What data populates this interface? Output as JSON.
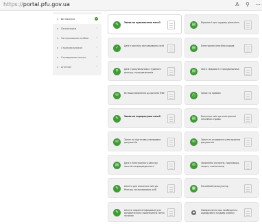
{
  "browser": {
    "url_scheme": "https://",
    "url_host": "portal.pfu.gov.ua",
    "reader_icon": "A",
    "zoom_icon": "⚲",
    "more_icon": "⋯"
  },
  "sidebar": {
    "items": [
      {
        "label": "Всі послуги",
        "badge": "8",
        "active": true
      },
      {
        "label": "Пенсіонерам",
        "chevron": "›"
      },
      {
        "label": "Застрахованим особам",
        "chevron": "›"
      },
      {
        "label": "Страхувальникам",
        "chevron": "›"
      },
      {
        "label": "Отримувачам послуг",
        "chevron": "›"
      },
      {
        "label": "Агентам",
        "chevron": "›"
      }
    ]
  },
  "services": [
    {
      "text": "Заява на призначення пенсії",
      "bold": true,
      "icon": "✎",
      "icon_color": "#3f9b34",
      "highlight": true
    },
    {
      "text": "Відомості про трудову діяльність",
      "icon": "▤",
      "icon_color": "#3f9b34"
    },
    {
      "text": "Дані з реєстру застрахованих осіб",
      "icon": "✓",
      "icon_color": "#3f9b34"
    },
    {
      "text": "Електронна пенсійна справа",
      "icon": "▤",
      "icon_color": "#3f9b34"
    },
    {
      "text": "Дані страхувальника з Єдиного реєстру страхувальників",
      "icon": "⚲",
      "icon_color": "#3f9b34"
    },
    {
      "text": "Звіти і відомості страхувальника",
      "icon": "▤",
      "icon_color": "#3f9b34"
    },
    {
      "text": "Всі ваші звернення до органів ПФУ",
      "icon": "✉",
      "icon_color": "#3f9b34"
    },
    {
      "text": "Запис на прийом",
      "icon": "◷",
      "icon_color": "#3f9b34"
    },
    {
      "text": "Заява на перерахунок пенсії",
      "bold": true,
      "icon": "✎",
      "icon_color": "#3f9b34"
    },
    {
      "text": "Внесення змін до електронної пенсійної справи",
      "icon": "▤",
      "icon_color": "#3f9b34"
    },
    {
      "text": "Запит на підготовку паперових документів",
      "icon": "✉",
      "icon_color": "#3f9b34"
    },
    {
      "text": "Запит на отримання електронних документів",
      "icon": "✉",
      "icon_color": "#3f9b34"
    },
    {
      "text": "Дані з Електронного реєстру листків непрацездатності",
      "icon": "▤",
      "icon_color": "#3f9b34"
    },
    {
      "text": "Звернення (питання, пропозиція, скарга, клопотання)",
      "icon": "✉",
      "icon_color": "#3f9b34"
    },
    {
      "text": "Анкета для внесення змін до Реєстру застрахованих осіб",
      "icon": "✎",
      "icon_color": "#3f9b34"
    },
    {
      "text": "Пенсійний калькулятор",
      "icon": "▦",
      "icon_color": "#3f9b34"
    },
    {
      "text": "Анкета надання інформації для автоматичного призначення пенсії за віком",
      "icon": "✎",
      "icon_color": "#3f9b34"
    },
    {
      "text": "Повідомлення про необхідність оцифрувати трудову книжку",
      "icon": "●",
      "icon_color": "#6a6a6a",
      "small_icon": true
    }
  ]
}
